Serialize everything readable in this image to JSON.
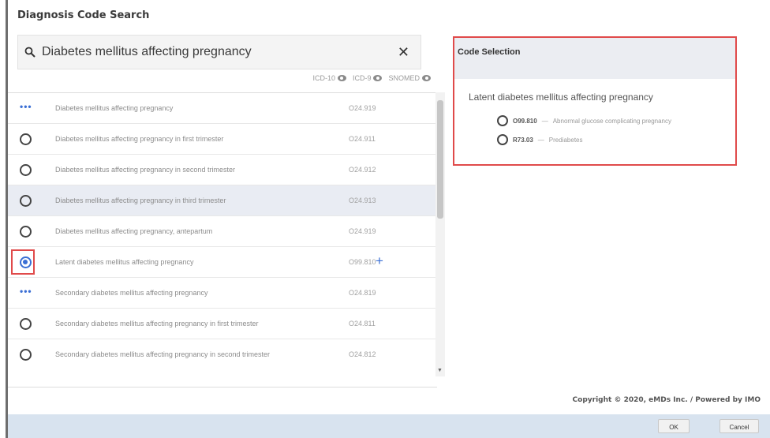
{
  "dialog": {
    "title": "Diagnosis Code Search"
  },
  "search": {
    "value": "Diabetes mellitus affecting pregnancy"
  },
  "code_sets": [
    {
      "label": "ICD-10"
    },
    {
      "label": "ICD-9"
    },
    {
      "label": "SNOMED"
    }
  ],
  "results": [
    {
      "selector": "dots",
      "description": "Diabetes mellitus affecting pregnancy",
      "code": "O24.919"
    },
    {
      "selector": "radio",
      "description": "Diabetes mellitus affecting pregnancy in first trimester",
      "code": "O24.911"
    },
    {
      "selector": "radio",
      "description": "Diabetes mellitus affecting pregnancy in second trimester",
      "code": "O24.912"
    },
    {
      "selector": "radio",
      "description": "Diabetes mellitus affecting pregnancy in third trimester",
      "code": "O24.913"
    },
    {
      "selector": "radio",
      "description": "Diabetes mellitus affecting pregnancy, antepartum",
      "code": "O24.919"
    },
    {
      "selector": "radio-checked",
      "description": "Latent diabetes mellitus affecting pregnancy",
      "code": "O99.810"
    },
    {
      "selector": "dots",
      "description": "Secondary diabetes mellitus affecting pregnancy",
      "code": "O24.819"
    },
    {
      "selector": "radio",
      "description": "Secondary diabetes mellitus affecting pregnancy in first trimester",
      "code": "O24.811"
    },
    {
      "selector": "radio",
      "description": "Secondary diabetes mellitus affecting pregnancy in second trimester",
      "code": "O24.812"
    }
  ],
  "code_selection": {
    "title": "Code Selection",
    "heading": "Latent diabetes mellitus affecting pregnancy",
    "options": [
      {
        "code": "O99.810",
        "separator": " — ",
        "description": "Abnormal glucose complicating pregnancy"
      },
      {
        "code": "R73.03",
        "separator": " — ",
        "description": "Prediabetes"
      }
    ]
  },
  "footer": {
    "copyright": "Copyright © 2020, eMDs Inc. / Powered by IMO",
    "ok_label": "OK",
    "cancel_label": "Cancel"
  },
  "colors": {
    "accent": "#3b6fd4",
    "annotation": "#e04a4a",
    "footer_bar": "#d8e3ef"
  }
}
